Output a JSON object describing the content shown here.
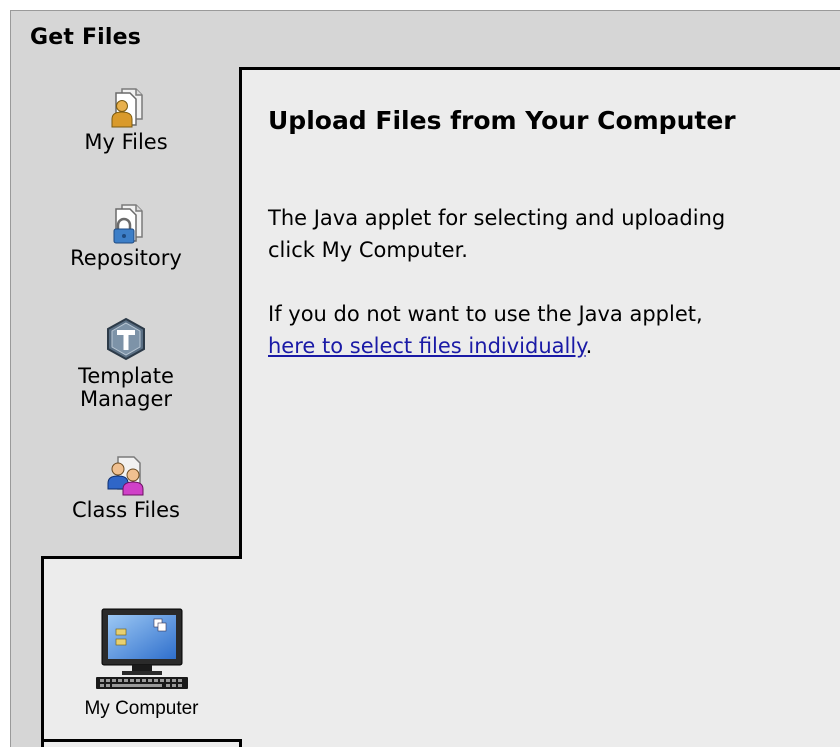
{
  "window": {
    "title": "Get Files"
  },
  "sidebar": {
    "items": [
      {
        "label": "My Files",
        "icon": "user-files-icon"
      },
      {
        "label": "Repository",
        "icon": "locked-files-icon"
      },
      {
        "label": "Template\nManager",
        "icon": "template-manager-icon"
      },
      {
        "label": "Class Files",
        "icon": "class-files-icon"
      },
      {
        "label": "My Computer",
        "icon": "computer-icon",
        "active": true
      }
    ]
  },
  "content": {
    "heading": "Upload Files from Your Computer",
    "para1_line1": "The Java applet for selecting and uploading",
    "para1_line2": "click My Computer.",
    "para2_line1": "If you do not want to use the Java applet,",
    "para2_link": "here to select files individually",
    "para2_after": "."
  },
  "colors": {
    "panel_bg": "#ececec",
    "chrome_bg": "#d6d6d6",
    "link": "#1a1aa6"
  }
}
